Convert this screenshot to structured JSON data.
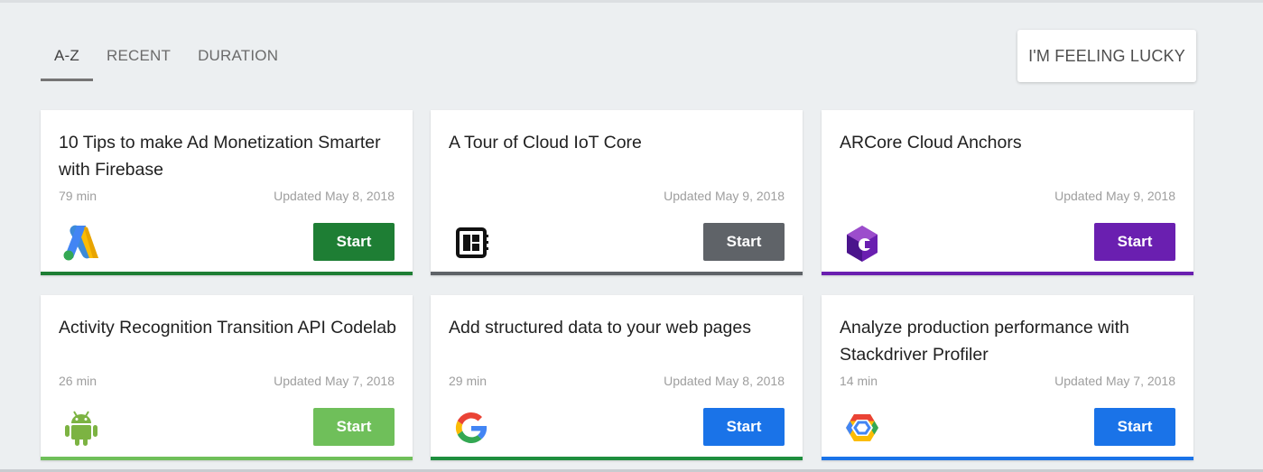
{
  "tabs": [
    {
      "label": "A-Z"
    },
    {
      "label": "RECENT"
    },
    {
      "label": "DURATION"
    }
  ],
  "lucky_button": "I'M FEELING LUCKY",
  "cards": [
    {
      "title": "10 Tips to make Ad Monetization Smarter with Firebase",
      "duration": "79 min",
      "updated": "Updated May 8, 2018",
      "start": "Start",
      "icon": "google-ads-icon",
      "color": "#1e7e34"
    },
    {
      "title": "A Tour of Cloud IoT Core",
      "duration": "",
      "updated": "Updated May 9, 2018",
      "start": "Start",
      "icon": "iot-board-icon",
      "color": "#5f6368"
    },
    {
      "title": "ARCore Cloud Anchors",
      "duration": "",
      "updated": "Updated May 9, 2018",
      "start": "Start",
      "icon": "arcore-icon",
      "color": "#6a1fb0"
    },
    {
      "title": "Activity Recognition Transition API Codelab",
      "duration": "26 min",
      "updated": "Updated May 7, 2018",
      "start": "Start",
      "icon": "android-icon",
      "color": "#6fbf5a"
    },
    {
      "title": "Add structured data to your web pages",
      "duration": "29 min",
      "updated": "Updated May 8, 2018",
      "start": "Start",
      "icon": "google-g-icon",
      "color": "#1a73e8"
    },
    {
      "title": "Analyze production performance with Stackdriver Profiler",
      "duration": "14 min",
      "updated": "Updated May 7, 2018",
      "start": "Start",
      "icon": "google-cloud-icon",
      "color": "#1a73e8"
    }
  ],
  "card_borders": [
    "#1e7e34",
    "#5f6368",
    "#6a1fb0",
    "#6fbf5a",
    "#1e8e3e",
    "#1a73e8"
  ]
}
